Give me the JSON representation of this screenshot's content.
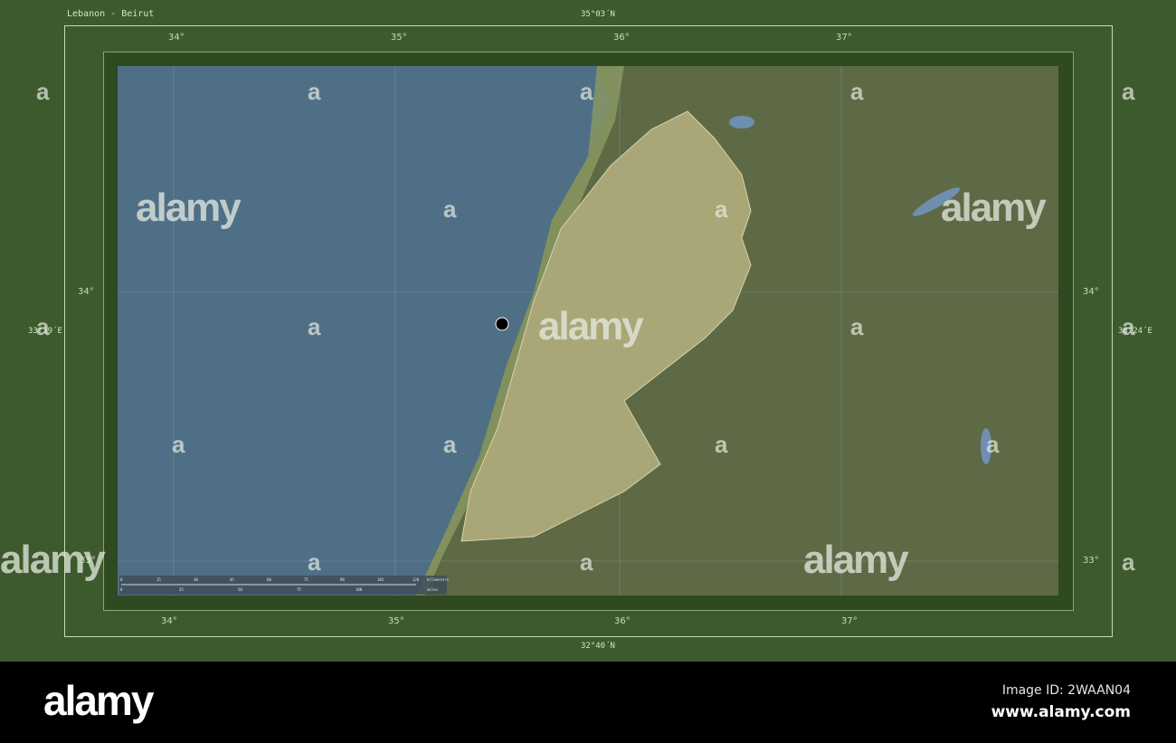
{
  "title": "Lebanon - Beirut",
  "frame": {
    "top_lat": "35°03´N",
    "bottom_lat": "32°40´N",
    "left_lon": "33°19´E",
    "right_lon": "38°24´E"
  },
  "lon_ticks": [
    "34°",
    "35°",
    "36°",
    "37°"
  ],
  "lat_ticks": [
    "34°",
    "33°"
  ],
  "scale_bar": {
    "km_ticks": [
      "0",
      "15",
      "30",
      "45",
      "60",
      "75",
      "90",
      "105",
      "120"
    ],
    "km_unit": "kilometers",
    "mi_ticks": [
      "0",
      "25",
      "50",
      "75",
      "100"
    ],
    "mi_unit": "miles"
  },
  "watermark": "alamy",
  "watermark_mark": "a",
  "footer": {
    "logo": "alamy",
    "image_id": "Image ID: 2WAAN04",
    "site": "www.alamy.com"
  },
  "colors": {
    "frame": "#3d5a2c",
    "sea": "#4f6f86",
    "land": "#5e6a45",
    "highlight": "#a9a777"
  }
}
